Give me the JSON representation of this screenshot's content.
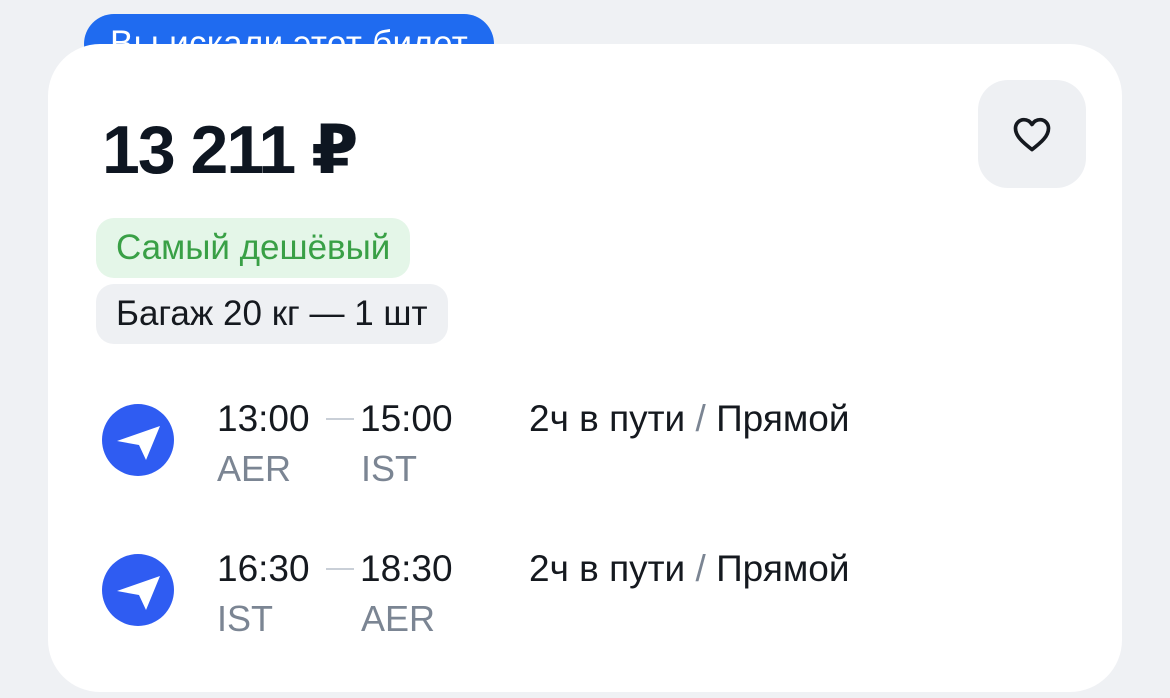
{
  "badge": {
    "label": "Вы искали этот билет"
  },
  "ticket": {
    "price": "13 211 ₽",
    "tags": {
      "cheapest": "Самый дешёвый",
      "baggage": "Багаж 20 кг — 1 шт"
    },
    "segments": [
      {
        "dep_time": "13:00",
        "arr_time": "15:00",
        "dep_code": "AER",
        "arr_code": "IST",
        "duration": "2ч в пути",
        "separator": "/",
        "stops": "Прямой"
      },
      {
        "dep_time": "16:30",
        "arr_time": "18:30",
        "dep_code": "IST",
        "arr_code": "AER",
        "duration": "2ч в пути",
        "separator": "/",
        "stops": "Прямой"
      }
    ],
    "airline_icon": "paper-plane-airline-logo",
    "favorite_icon": "heart-icon"
  },
  "colors": {
    "accent": "#1f6bf0",
    "logo": "#2f5cf2",
    "cheapest_text": "#39a046",
    "cheapest_bg": "#e4f6e8"
  }
}
